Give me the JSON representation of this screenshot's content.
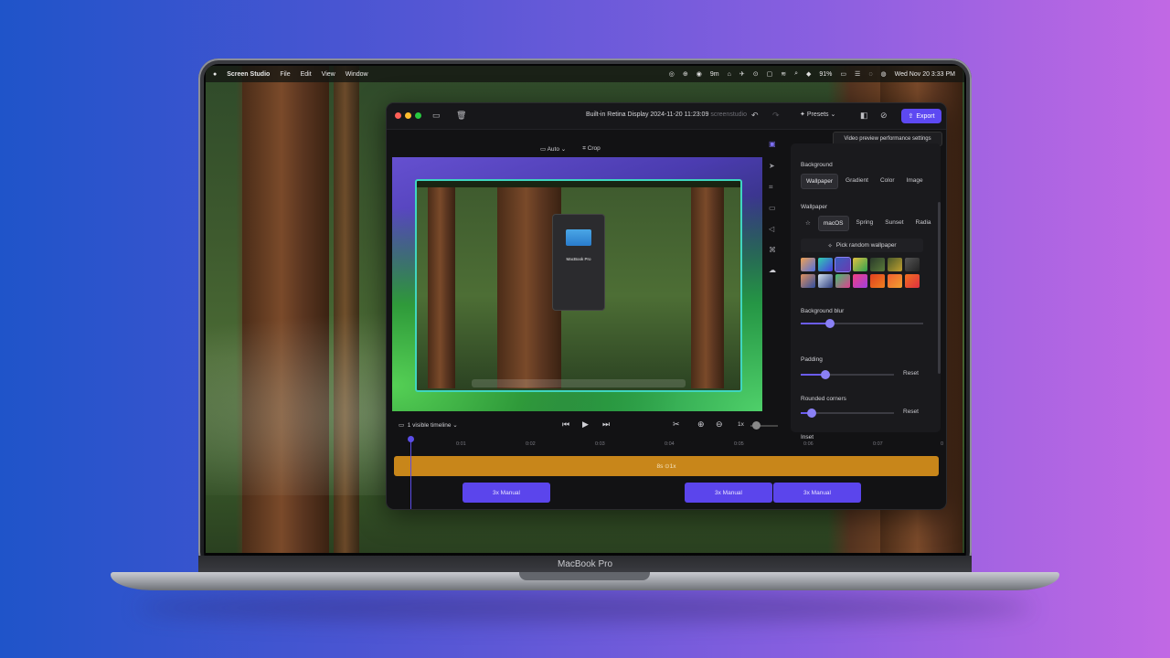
{
  "laptop": {
    "brand_label": "MacBook Pro"
  },
  "menubar": {
    "apple": "",
    "app": "Screen Studio",
    "menus": [
      "File",
      "Edit",
      "View",
      "Window"
    ],
    "timer": "9m",
    "battery": "91%",
    "datetime": "Wed Nov 20  3:33 PM"
  },
  "window": {
    "title": "Built-in Retina Display 2024-11-20 11:23:09",
    "title_suffix": "screenstudio",
    "presets_label": "Presets",
    "export_label": "Export",
    "tooltip": "Video preview performance settings"
  },
  "toolbar": {
    "auto_label": "Auto",
    "crop_label": "Crop"
  },
  "preview": {
    "dialog_title": "MacBook Pro"
  },
  "panel": {
    "background_label": "Background",
    "background_tabs": [
      "Wallpaper",
      "Gradient",
      "Color",
      "Image"
    ],
    "wallpaper_label": "Wallpaper",
    "wallpaper_tabs": [
      "macOS",
      "Spring",
      "Sunset",
      "Radia"
    ],
    "pick_random": "Pick random wallpaper",
    "blur_label": "Background blur",
    "blur_value": 0.24,
    "padding_label": "Padding",
    "padding_value": 0.26,
    "rounded_label": "Rounded corners",
    "rounded_value": 0.12,
    "inset_label": "Inset",
    "reset_label": "Reset"
  },
  "controls": {
    "visible_timeline": "1 visible timeline",
    "speed": "1x"
  },
  "timeline": {
    "ticks": [
      "0:01",
      "0:02",
      "0:03",
      "0:04",
      "0:05",
      "0:06",
      "0:07",
      "0"
    ],
    "clip_label": "8s  ⊙1x",
    "zoom_segments": [
      {
        "label": "3x  Manual"
      },
      {
        "label": "3x  Manual"
      },
      {
        "label": "3x  Manual"
      }
    ]
  },
  "colors": {
    "accent": "#5d49f2",
    "clip": "#c8861a",
    "zoom": "#5b45ec"
  }
}
